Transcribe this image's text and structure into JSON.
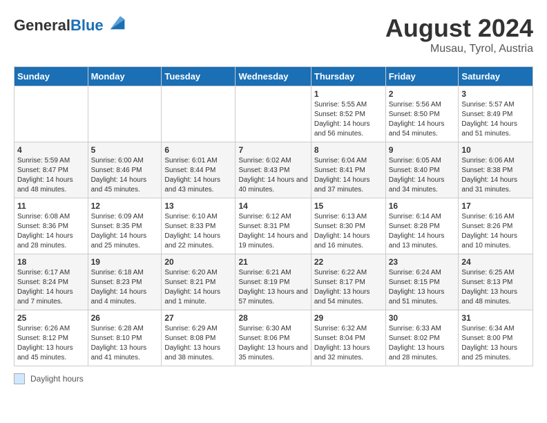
{
  "header": {
    "logo_general": "General",
    "logo_blue": "Blue",
    "month_year": "August 2024",
    "location": "Musau, Tyrol, Austria"
  },
  "calendar": {
    "days_of_week": [
      "Sunday",
      "Monday",
      "Tuesday",
      "Wednesday",
      "Thursday",
      "Friday",
      "Saturday"
    ],
    "weeks": [
      [
        {
          "day": "",
          "info": ""
        },
        {
          "day": "",
          "info": ""
        },
        {
          "day": "",
          "info": ""
        },
        {
          "day": "",
          "info": ""
        },
        {
          "day": "1",
          "info": "Sunrise: 5:55 AM\nSunset: 8:52 PM\nDaylight: 14 hours and 56 minutes."
        },
        {
          "day": "2",
          "info": "Sunrise: 5:56 AM\nSunset: 8:50 PM\nDaylight: 14 hours and 54 minutes."
        },
        {
          "day": "3",
          "info": "Sunrise: 5:57 AM\nSunset: 8:49 PM\nDaylight: 14 hours and 51 minutes."
        }
      ],
      [
        {
          "day": "4",
          "info": "Sunrise: 5:59 AM\nSunset: 8:47 PM\nDaylight: 14 hours and 48 minutes."
        },
        {
          "day": "5",
          "info": "Sunrise: 6:00 AM\nSunset: 8:46 PM\nDaylight: 14 hours and 45 minutes."
        },
        {
          "day": "6",
          "info": "Sunrise: 6:01 AM\nSunset: 8:44 PM\nDaylight: 14 hours and 43 minutes."
        },
        {
          "day": "7",
          "info": "Sunrise: 6:02 AM\nSunset: 8:43 PM\nDaylight: 14 hours and 40 minutes."
        },
        {
          "day": "8",
          "info": "Sunrise: 6:04 AM\nSunset: 8:41 PM\nDaylight: 14 hours and 37 minutes."
        },
        {
          "day": "9",
          "info": "Sunrise: 6:05 AM\nSunset: 8:40 PM\nDaylight: 14 hours and 34 minutes."
        },
        {
          "day": "10",
          "info": "Sunrise: 6:06 AM\nSunset: 8:38 PM\nDaylight: 14 hours and 31 minutes."
        }
      ],
      [
        {
          "day": "11",
          "info": "Sunrise: 6:08 AM\nSunset: 8:36 PM\nDaylight: 14 hours and 28 minutes."
        },
        {
          "day": "12",
          "info": "Sunrise: 6:09 AM\nSunset: 8:35 PM\nDaylight: 14 hours and 25 minutes."
        },
        {
          "day": "13",
          "info": "Sunrise: 6:10 AM\nSunset: 8:33 PM\nDaylight: 14 hours and 22 minutes."
        },
        {
          "day": "14",
          "info": "Sunrise: 6:12 AM\nSunset: 8:31 PM\nDaylight: 14 hours and 19 minutes."
        },
        {
          "day": "15",
          "info": "Sunrise: 6:13 AM\nSunset: 8:30 PM\nDaylight: 14 hours and 16 minutes."
        },
        {
          "day": "16",
          "info": "Sunrise: 6:14 AM\nSunset: 8:28 PM\nDaylight: 14 hours and 13 minutes."
        },
        {
          "day": "17",
          "info": "Sunrise: 6:16 AM\nSunset: 8:26 PM\nDaylight: 14 hours and 10 minutes."
        }
      ],
      [
        {
          "day": "18",
          "info": "Sunrise: 6:17 AM\nSunset: 8:24 PM\nDaylight: 14 hours and 7 minutes."
        },
        {
          "day": "19",
          "info": "Sunrise: 6:18 AM\nSunset: 8:23 PM\nDaylight: 14 hours and 4 minutes."
        },
        {
          "day": "20",
          "info": "Sunrise: 6:20 AM\nSunset: 8:21 PM\nDaylight: 14 hours and 1 minute."
        },
        {
          "day": "21",
          "info": "Sunrise: 6:21 AM\nSunset: 8:19 PM\nDaylight: 13 hours and 57 minutes."
        },
        {
          "day": "22",
          "info": "Sunrise: 6:22 AM\nSunset: 8:17 PM\nDaylight: 13 hours and 54 minutes."
        },
        {
          "day": "23",
          "info": "Sunrise: 6:24 AM\nSunset: 8:15 PM\nDaylight: 13 hours and 51 minutes."
        },
        {
          "day": "24",
          "info": "Sunrise: 6:25 AM\nSunset: 8:13 PM\nDaylight: 13 hours and 48 minutes."
        }
      ],
      [
        {
          "day": "25",
          "info": "Sunrise: 6:26 AM\nSunset: 8:12 PM\nDaylight: 13 hours and 45 minutes."
        },
        {
          "day": "26",
          "info": "Sunrise: 6:28 AM\nSunset: 8:10 PM\nDaylight: 13 hours and 41 minutes."
        },
        {
          "day": "27",
          "info": "Sunrise: 6:29 AM\nSunset: 8:08 PM\nDaylight: 13 hours and 38 minutes."
        },
        {
          "day": "28",
          "info": "Sunrise: 6:30 AM\nSunset: 8:06 PM\nDaylight: 13 hours and 35 minutes."
        },
        {
          "day": "29",
          "info": "Sunrise: 6:32 AM\nSunset: 8:04 PM\nDaylight: 13 hours and 32 minutes."
        },
        {
          "day": "30",
          "info": "Sunrise: 6:33 AM\nSunset: 8:02 PM\nDaylight: 13 hours and 28 minutes."
        },
        {
          "day": "31",
          "info": "Sunrise: 6:34 AM\nSunset: 8:00 PM\nDaylight: 13 hours and 25 minutes."
        }
      ]
    ]
  },
  "footer": {
    "daylight_label": "Daylight hours"
  }
}
